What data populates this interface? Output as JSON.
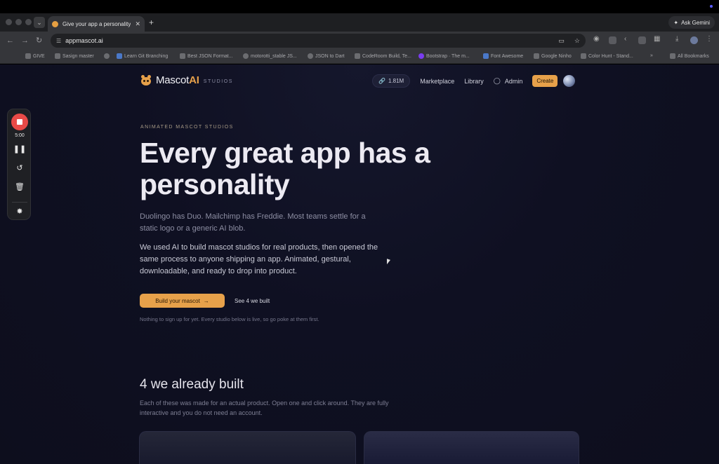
{
  "browser": {
    "tab_title": "Give your app a personality |",
    "new_tab": "+",
    "ask_gemini": "Ask Gemini",
    "url": "appmascot.ai",
    "bookmarks": [
      "GIVE",
      "Sasign master",
      "Learn Git Branching",
      "Best JSON Format...",
      "motorotti_stable JS...",
      "JSON to Dart",
      "CodeRoom Build, Te...",
      "Bootstrap · The m...",
      "Font Awesome",
      "Google Ninho",
      "Color Hunt - Stand..."
    ],
    "bookmarks_overflow": "»",
    "all_bookmarks": "All Bookmarks"
  },
  "recorder": {
    "time": "5:00"
  },
  "site": {
    "logo_main": "Mascot",
    "logo_accent": "AI",
    "logo_sub": "STUDIOS",
    "nav": {
      "count": "1.81M",
      "marketplace": "Marketplace",
      "library": "Library",
      "admin": "Admin",
      "create": "Create"
    },
    "hero": {
      "eyebrow": "ANIMATED MASCOT STUDIOS",
      "title": "Every great app has a personality",
      "lead1": "Duolingo has Duo. Mailchimp has Freddie. Most teams settle for a static logo or a generic AI blob.",
      "lead2": "We used AI to build mascot studios for real products, then opened the same process to anyone shipping an app. Animated, gestural, downloadable, and ready to drop into product.",
      "cta_primary": "Build your mascot",
      "cta_secondary": "See 4 we built",
      "note": "Nothing to sign up for yet. Every studio below is live, so go poke at them first."
    },
    "section": {
      "title": "4 we already built",
      "desc": "Each of these was made for an actual product. Open one and click around. They are fully interactive and you do not need an account."
    }
  },
  "colors": {
    "accent": "#e7a14a",
    "page_bg": "#0f1022",
    "record_red": "#e94a47"
  }
}
